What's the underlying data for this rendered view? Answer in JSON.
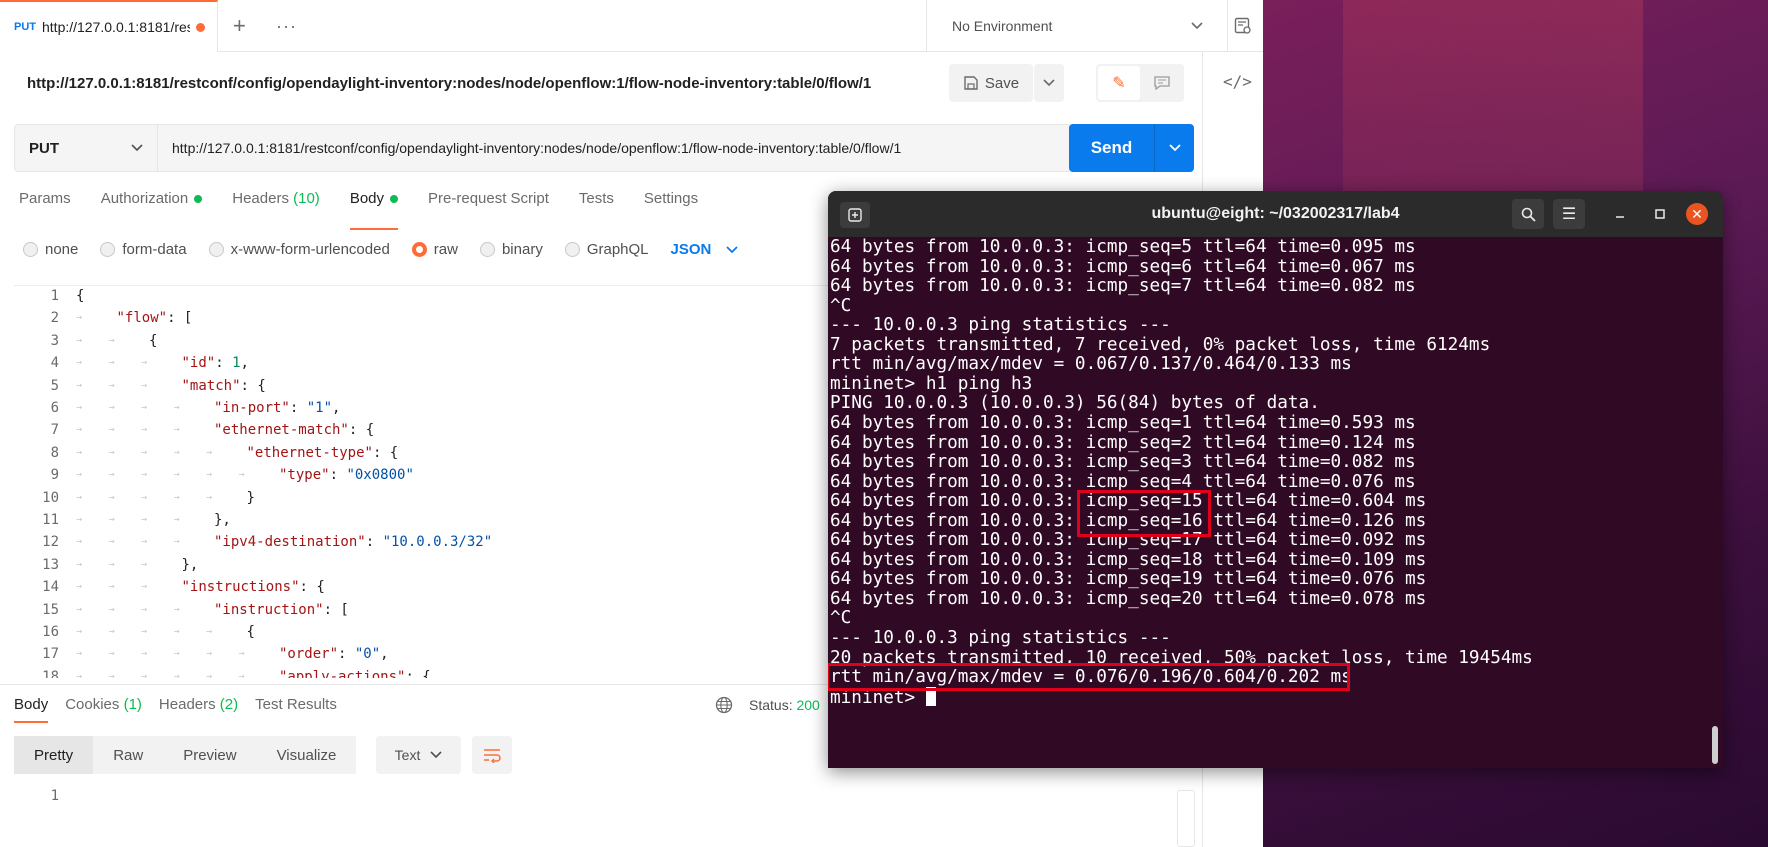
{
  "postman": {
    "tab": {
      "method": "PUT",
      "url": "http://127.0.0.1:8181/res"
    },
    "new_tab_icon": "plus-icon",
    "more_icon": "more-icon",
    "environment": "No Environment",
    "request_title": "http://127.0.0.1:8181/restconf/config/opendaylight-inventory:nodes/node/openflow:1/flow-node-inventory:table/0/flow/1",
    "save_label": "Save",
    "method": "PUT",
    "url": "http://127.0.0.1:8181/restconf/config/opendaylight-inventory:nodes/node/openflow:1/flow-node-inventory:table/0/flow/1",
    "send_label": "Send",
    "request_tabs": [
      {
        "label": "Params"
      },
      {
        "label": "Authorization"
      },
      {
        "label": "Headers",
        "count": "(10)"
      },
      {
        "label": "Body"
      },
      {
        "label": "Pre-request Script"
      },
      {
        "label": "Tests"
      },
      {
        "label": "Settings"
      }
    ],
    "body_types": [
      "none",
      "form-data",
      "x-www-form-urlencoded",
      "raw",
      "binary",
      "GraphQL"
    ],
    "body_format": "JSON",
    "body_lines": [
      {
        "n": "1",
        "indent": 0,
        "guides": 0,
        "html": "{"
      },
      {
        "n": "2",
        "indent": 1,
        "guides": 1,
        "html": "<span class='k'>\"flow\"</span>: ["
      },
      {
        "n": "3",
        "indent": 2,
        "guides": 2,
        "html": "{"
      },
      {
        "n": "4",
        "indent": 3,
        "guides": 3,
        "html": "<span class='k'>\"id\"</span>: <span class='n'>1</span>,"
      },
      {
        "n": "5",
        "indent": 3,
        "guides": 3,
        "html": "<span class='k'>\"match\"</span>: {"
      },
      {
        "n": "6",
        "indent": 4,
        "guides": 4,
        "html": "<span class='k'>\"in-port\"</span>: <span class='s'>\"1\"</span>,"
      },
      {
        "n": "7",
        "indent": 4,
        "guides": 4,
        "html": "<span class='k'>\"ethernet-match\"</span>: {"
      },
      {
        "n": "8",
        "indent": 5,
        "guides": 5,
        "html": "<span class='k'>\"ethernet-type\"</span>: {"
      },
      {
        "n": "9",
        "indent": 6,
        "guides": 6,
        "html": "<span class='k'>\"type\"</span>: <span class='s'>\"0x0800\"</span>"
      },
      {
        "n": "10",
        "indent": 5,
        "guides": 5,
        "html": "}"
      },
      {
        "n": "11",
        "indent": 4,
        "guides": 4,
        "html": "},"
      },
      {
        "n": "12",
        "indent": 4,
        "guides": 4,
        "html": "<span class='k'>\"ipv4-destination\"</span>: <span class='s'>\"10.0.0.3/32\"</span>"
      },
      {
        "n": "13",
        "indent": 3,
        "guides": 3,
        "html": "},"
      },
      {
        "n": "14",
        "indent": 3,
        "guides": 3,
        "html": "<span class='k'>\"instructions\"</span>: {"
      },
      {
        "n": "15",
        "indent": 4,
        "guides": 4,
        "html": "<span class='k'>\"instruction\"</span>: ["
      },
      {
        "n": "16",
        "indent": 5,
        "guides": 5,
        "html": "{"
      },
      {
        "n": "17",
        "indent": 6,
        "guides": 6,
        "html": "<span class='k'>\"order\"</span>: <span class='s'>\"0\"</span>,"
      },
      {
        "n": "18",
        "indent": 6,
        "guides": 6,
        "html": "<span class='k'>\"apply-actions\"</span>: {"
      }
    ],
    "response_tabs": [
      {
        "label": "Body"
      },
      {
        "label": "Cookies",
        "count": "(1)"
      },
      {
        "label": "Headers",
        "count": "(2)"
      },
      {
        "label": "Test Results"
      }
    ],
    "status_label": "Status:",
    "status_value": "200",
    "view_modes": [
      "Pretty",
      "Raw",
      "Preview",
      "Visualize"
    ],
    "response_format": "Text",
    "response_line": "1",
    "colors": {
      "accent": "#ff6c37",
      "send": "#097bed",
      "ok": "#0cbb52"
    }
  },
  "terminal": {
    "title": "ubuntu@eight: ~/032002317/lab4",
    "lines": [
      "64 bytes from 10.0.0.3: icmp_seq=5 ttl=64 time=0.095 ms",
      "64 bytes from 10.0.0.3: icmp_seq=6 ttl=64 time=0.067 ms",
      "64 bytes from 10.0.0.3: icmp_seq=7 ttl=64 time=0.082 ms",
      "^C",
      "--- 10.0.0.3 ping statistics ---",
      "7 packets transmitted, 7 received, 0% packet loss, time 6124ms",
      "rtt min/avg/max/mdev = 0.067/0.137/0.464/0.133 ms",
      "mininet> h1 ping h3",
      "PING 10.0.0.3 (10.0.0.3) 56(84) bytes of data.",
      "64 bytes from 10.0.0.3: icmp_seq=1 ttl=64 time=0.593 ms",
      "64 bytes from 10.0.0.3: icmp_seq=2 ttl=64 time=0.124 ms",
      "64 bytes from 10.0.0.3: icmp_seq=3 ttl=64 time=0.082 ms",
      "64 bytes from 10.0.0.3: icmp_seq=4 ttl=64 time=0.076 ms",
      "64 bytes from 10.0.0.3: icmp_seq=15 ttl=64 time=0.604 ms",
      "64 bytes from 10.0.0.3: icmp_seq=16 ttl=64 time=0.126 ms",
      "64 bytes from 10.0.0.3: icmp_seq=17 ttl=64 time=0.092 ms",
      "64 bytes from 10.0.0.3: icmp_seq=18 ttl=64 time=0.109 ms",
      "64 bytes from 10.0.0.3: icmp_seq=19 ttl=64 time=0.076 ms",
      "64 bytes from 10.0.0.3: icmp_seq=20 ttl=64 time=0.078 ms",
      "^C",
      "--- 10.0.0.3 ping statistics ---",
      "20 packets transmitted, 10 received, 50% packet loss, time 19454ms",
      "rtt min/avg/max/mdev = 0.076/0.196/0.604/0.202 ms"
    ],
    "prompt": "mininet> ",
    "colors": {
      "background": "#300a24",
      "highlight": "#e0001b",
      "close": "#e95420"
    }
  }
}
